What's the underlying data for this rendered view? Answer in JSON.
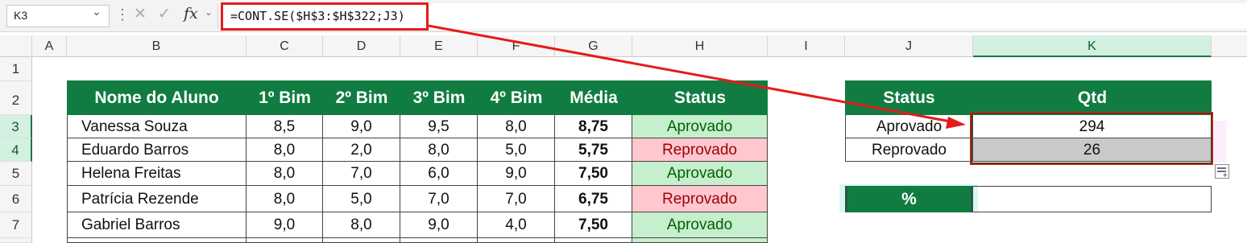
{
  "formula_bar": {
    "name_box": "K3",
    "formula": "=CONT.SE($H$3:$H$322;J3)"
  },
  "columns": [
    "A",
    "B",
    "C",
    "D",
    "E",
    "F",
    "G",
    "H",
    "I",
    "J",
    "K"
  ],
  "rows": [
    "1",
    "2",
    "3",
    "4",
    "5",
    "6",
    "7"
  ],
  "table": {
    "headers": [
      "Nome do Aluno",
      "1º Bim",
      "2º Bim",
      "3º Bim",
      "4º Bim",
      "Média",
      "Status"
    ],
    "rows": [
      {
        "name": "Vanessa Souza",
        "b1": "8,5",
        "b2": "9,0",
        "b3": "9,5",
        "b4": "8,0",
        "media": "8,75",
        "status": "Aprovado"
      },
      {
        "name": "Eduardo Barros",
        "b1": "8,0",
        "b2": "2,0",
        "b3": "8,0",
        "b4": "5,0",
        "media": "5,75",
        "status": "Reprovado"
      },
      {
        "name": "Helena Freitas",
        "b1": "8,0",
        "b2": "7,0",
        "b3": "6,0",
        "b4": "9,0",
        "media": "7,50",
        "status": "Aprovado"
      },
      {
        "name": "Patrícia Rezende",
        "b1": "8,0",
        "b2": "5,0",
        "b3": "7,0",
        "b4": "7,0",
        "media": "6,75",
        "status": "Reprovado"
      },
      {
        "name": "Gabriel Barros",
        "b1": "9,0",
        "b2": "8,0",
        "b3": "9,0",
        "b4": "4,0",
        "media": "7,50",
        "status": "Aprovado"
      }
    ]
  },
  "summary": {
    "headers": [
      "Status",
      "Qtd"
    ],
    "rows": [
      {
        "status": "Aprovado",
        "qtd": "294"
      },
      {
        "status": "Reprovado",
        "qtd": "26"
      }
    ],
    "percent_label": "%"
  },
  "colors": {
    "header_green": "#107c41",
    "approved_fill": "#c6efce",
    "failed_fill": "#ffc7ce",
    "highlight_red": "#e51b1b"
  }
}
